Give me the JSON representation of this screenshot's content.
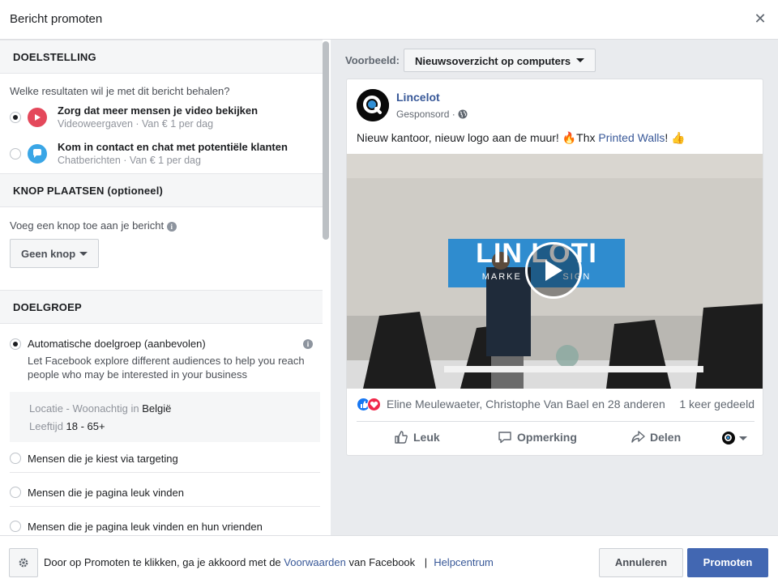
{
  "header": {
    "title": "Bericht promoten"
  },
  "objective": {
    "heading": "DOELSTELLING",
    "question": "Welke resultaten wil je met dit bericht behalen?",
    "options": [
      {
        "title": "Zorg dat meer mensen je video bekijken",
        "sub": "Videoweergaven · Van € 1 per dag",
        "selected": true,
        "icon": "play-icon",
        "color": "#e4485b"
      },
      {
        "title": "Kom in contact en chat met potentiële klanten",
        "sub": "Chatberichten · Van € 1 per dag",
        "selected": false,
        "icon": "chat-icon",
        "color": "#3aa6e6"
      }
    ]
  },
  "button_section": {
    "heading": "KNOP PLAATSEN (optioneel)",
    "prompt": "Voeg een knop toe aan je bericht",
    "select_value": "Geen knop"
  },
  "audience": {
    "heading": "DOELGROEP",
    "auto_title": "Automatische doelgroep (aanbevolen)",
    "auto_desc_line1": "Let Facebook explore different audiences to help you reach",
    "auto_desc_line2": "people who may be interested in your business",
    "location_label": "Locatie - Woonachtig in",
    "location_value": "België",
    "age_label": "Leeftijd",
    "age_value": "18 - 65+",
    "other_options": [
      "Mensen die je kiest via targeting",
      "Mensen die je pagina leuk vinden",
      "Mensen die je pagina leuk vinden en hun vrienden"
    ]
  },
  "preview": {
    "label": "Voorbeeld:",
    "placement": "Nieuwsoverzicht op computers",
    "post": {
      "page_name": "Lincelot",
      "sponsored": "Gesponsord ·",
      "text_before": "Nieuw kantoor, nieuw logo aan de muur! 🔥Thx ",
      "text_link": "Printed Walls",
      "text_after": "! 👍",
      "video_sign_main": "LIN  LOTI",
      "video_sign_sub": "MARKE          SIGN",
      "reactions": "Eline Meulewaeter, Christophe Van Bael en 28 anderen",
      "shares": "1 keer gedeeld",
      "actions": {
        "like": "Leuk",
        "comment": "Opmerking",
        "share": "Delen"
      }
    }
  },
  "footer": {
    "text_before": "Door op Promoten te klikken, ga je akkoord met de ",
    "terms_link": "Voorwaarden",
    "text_after": " van Facebook",
    "separator": "|",
    "help_link": "Helpcentrum",
    "cancel": "Annuleren",
    "promote": "Promoten"
  },
  "colors": {
    "accent": "#4267b2",
    "link": "#385898",
    "panel_bg": "#e9ebee"
  }
}
